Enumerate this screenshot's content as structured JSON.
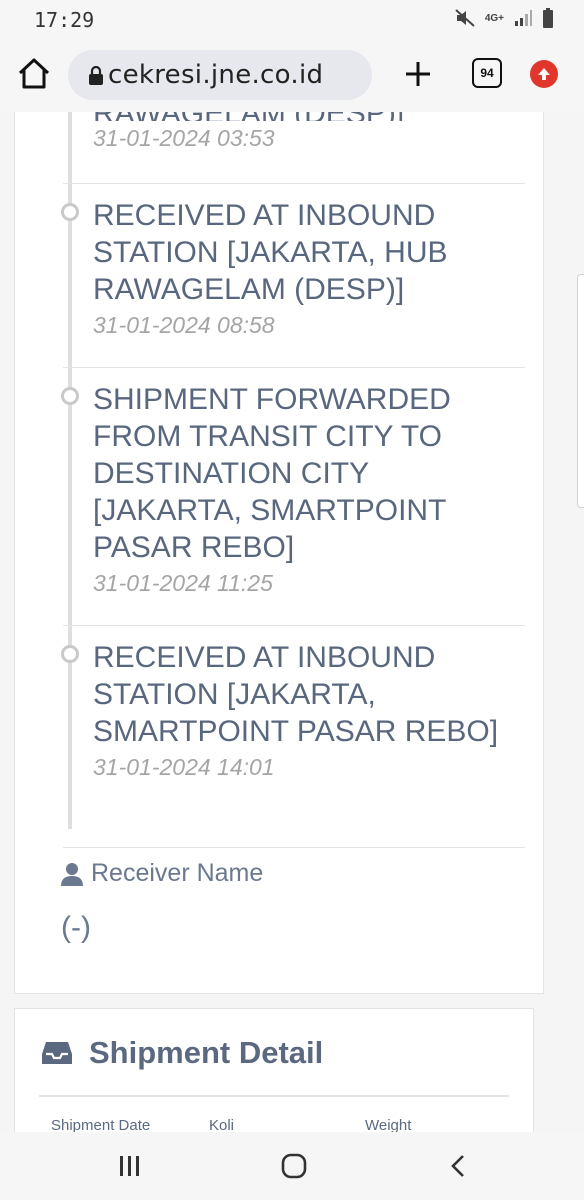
{
  "status_bar": {
    "time": "17:29",
    "network": "4G+"
  },
  "browser": {
    "url": "cekresi.jne.co.id",
    "tab_count": "94"
  },
  "tracking": {
    "entries": [
      {
        "title": "RAWAGELAM (DESP)]",
        "date": "31-01-2024 03:53"
      },
      {
        "title": "RECEIVED AT INBOUND STATION [JAKARTA, HUB RAWAGELAM (DESP)]",
        "date": "31-01-2024 08:58"
      },
      {
        "title": "SHIPMENT FORWARDED FROM TRANSIT CITY TO DESTINATION CITY [JAKARTA, SMARTPOINT PASAR REBO]",
        "date": "31-01-2024 11:25"
      },
      {
        "title": "RECEIVED AT INBOUND STATION [JAKARTA, SMARTPOINT PASAR REBO]",
        "date": "31-01-2024 14:01"
      }
    ]
  },
  "receiver": {
    "label": "Receiver Name",
    "value": "(-)"
  },
  "shipment_detail": {
    "title": "Shipment Detail",
    "columns": [
      "Shipment Date",
      "Koli",
      "Weight"
    ]
  },
  "colors": {
    "accent_text": "#59677e",
    "date_text": "#a5a5a5",
    "update_badge": "#e0362b"
  }
}
